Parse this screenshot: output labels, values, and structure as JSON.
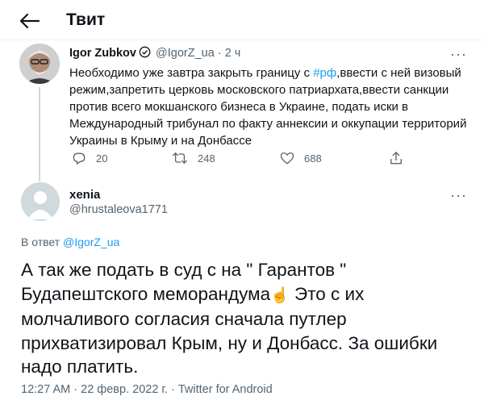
{
  "header": {
    "title": "Твит"
  },
  "tweet1": {
    "author_name": "Igor Zubkov",
    "handle": "@IgorZ_ua",
    "dot": "·",
    "time": "2 ч",
    "text_before": "Необходимо уже завтра закрыть границу с ",
    "hashtag": "#рф",
    "text_after": ",ввести с ней визовый режим,запретить церковь московского патриархата,ввести санкции против всего мокшанского бизнеса в Украине, подать иски в Международный трибунал по факту аннексии и оккупации территорий Украины в Крыму и на Донбассе",
    "more": "···",
    "replies": "20",
    "retweets": "248",
    "likes": "688"
  },
  "tweet2": {
    "author_name": "xenia",
    "handle": "@hrustaleova1771",
    "more": "···",
    "reply_prefix": "В ответ ",
    "reply_mention": "@IgorZ_ua",
    "text_part1": "А так же подать в суд с  на \" Гарантов \" Будапештского меморандума",
    "emoji": "☝️",
    "text_part2": " Это с их молчаливого согласия сначала путлер прихватизировал Крым, ну и Донбасс. За ошибки надо платить.",
    "timestamp": "12:27 AM · 22 февр. 2022 г. · Twitter for Android"
  },
  "colors": {
    "accent": "#1d9bf0",
    "secondary_text": "#536471",
    "primary_text": "#0f1419"
  },
  "icons": [
    "back-arrow-icon",
    "verified-badge-icon",
    "reply-icon",
    "retweet-icon",
    "like-icon",
    "share-icon"
  ]
}
